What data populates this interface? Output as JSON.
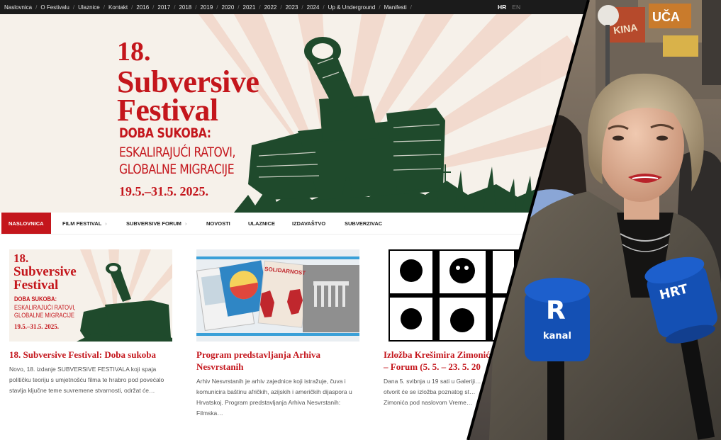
{
  "topbar": {
    "items": [
      "Naslovnica",
      "O Festivalu",
      "Ulaznice",
      "Kontakt",
      "2016",
      "2017",
      "2018",
      "2019",
      "2020",
      "2021",
      "2022",
      "2023",
      "2024",
      "Up & Underground",
      "Manifesti"
    ],
    "lang_active": "HR",
    "lang_inactive": "EN"
  },
  "hero": {
    "number": "18.",
    "name_line1": "Subversive",
    "name_line2": "Festival",
    "subtitle_line1": "DOBA SUKOBA:",
    "subtitle_line2": "ESKALIRAJUĆI RATOVI,",
    "subtitle_line3": "GLOBALNE MIGRACIJE",
    "dates": "19.5.–31.5. 2025."
  },
  "mainnav": {
    "items": [
      {
        "label": "NASLOVNICA",
        "active": true
      },
      {
        "label": "FILM FESTIVAL",
        "chevron": true
      },
      {
        "label": "SUBVERSIVE FORUM",
        "chevron": true
      },
      {
        "label": "NOVOSTI"
      },
      {
        "label": "ULAZNICE"
      },
      {
        "label": "IZDAVAŠTVO"
      },
      {
        "label": "SUBVERZIVAC"
      }
    ]
  },
  "thumb1": {
    "number": "18.",
    "name_line1": "Subversive",
    "name_line2": "Festival",
    "subtitle_line1": "DOBA SUKOBA:",
    "subtitle_line2": "ESKALIRAJUĆI RATOVI,",
    "subtitle_line3": "GLOBALNE MIGRACIJE",
    "dates": "19.5.–31.5. 2025."
  },
  "thumb2": {
    "book_label": "SOLIDARNOST"
  },
  "cards": [
    {
      "title": "18. Subversive Festival: Doba sukoba",
      "text": "Novo, 18. izdanje SUBVERSIVE FESTIVALA koji spaja političku teoriju s umjetnošću filma te hrabro pod povećalo stavlja ključne teme suvremene stvarnosti, održat će…"
    },
    {
      "title": "Program predstavljanja Arhiva Nesvrstanih",
      "text": "Arhiv Nesvrstanih je arhiv zajednice koji istražuje, čuva i komunicira baštinu afričkih, azijskih i američkih dijaspora u Hrvatskoj. Program predstavljanja Arhiva Nesvrstanih: Filmska…"
    },
    {
      "title": "Izložba Krešimira Zimonića – Forum (5. 5. – 23. 5. 20",
      "text": "Dana 5. svibnja u 19 sati u Galeriji… otvorit će se izložba poznatog st… Zimonića pod naslovom Vreme…"
    }
  ],
  "video": {
    "sign_left": "KINA",
    "sign_right": "UČA",
    "mic1_letter": "R",
    "mic1_text": "kanal",
    "mic2_text": "HRT"
  },
  "colors": {
    "festival_red": "#c4161c",
    "tank_green": "#1f4a2c",
    "hero_bg": "#f6f1ea",
    "topbar_bg": "#1b1b1b",
    "mic_blue": "#1450b4"
  }
}
